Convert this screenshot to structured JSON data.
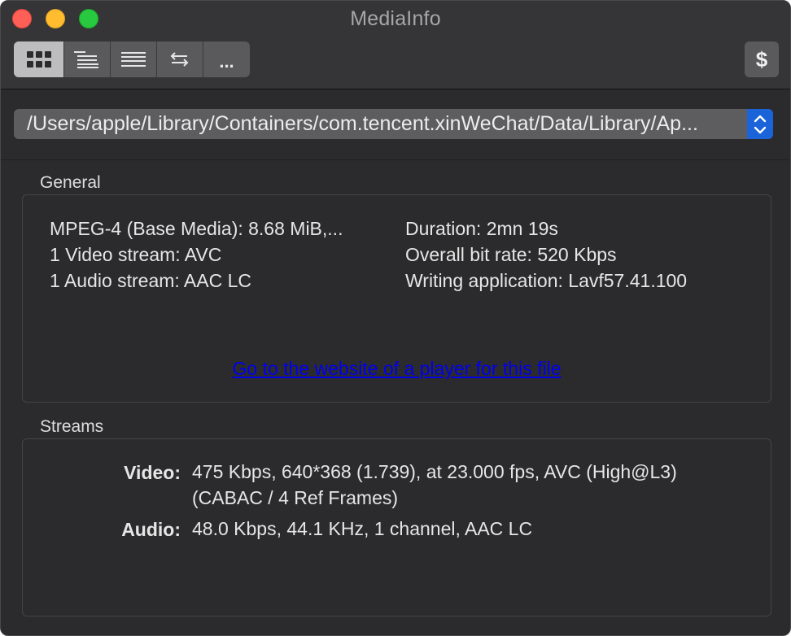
{
  "window": {
    "title": "MediaInfo"
  },
  "toolbar": {
    "view_buttons": [
      {
        "icon": "grid-icon",
        "active": true
      },
      {
        "icon": "tree-list-icon",
        "active": false
      },
      {
        "icon": "text-list-icon",
        "active": false
      },
      {
        "icon": "swap-arrows-icon",
        "active": false
      },
      {
        "icon": "more-icon",
        "label": "...",
        "active": false
      }
    ],
    "sponsor_label": "$"
  },
  "file_selector": {
    "value": "/Users/apple/Library/Containers/com.tencent.xinWeChat/Data/Library/Ap..."
  },
  "general": {
    "heading": "General",
    "left_lines": [
      "MPEG-4 (Base Media): 8.68 MiB,...",
      "1 Video stream: AVC",
      "1 Audio stream: AAC LC"
    ],
    "right_lines": [
      "Duration: 2mn 19s",
      "Overall bit rate: 520 Kbps",
      "Writing application: Lavf57.41.100"
    ],
    "player_link": "Go to the website of a player for this file"
  },
  "streams": {
    "heading": "Streams",
    "video_label": "Video:",
    "video_line1": "475 Kbps, 640*368 (1.739), at 23.000 fps, AVC (High@L3)",
    "video_line2": "(CABAC / 4 Ref Frames)",
    "audio_label": "Audio:",
    "audio_value": "48.0 Kbps, 44.1 KHz, 1 channel, AAC LC"
  },
  "colors": {
    "window_bg": "#2b2b2d",
    "link": "#0000ee",
    "accent": "#1a63d8"
  }
}
